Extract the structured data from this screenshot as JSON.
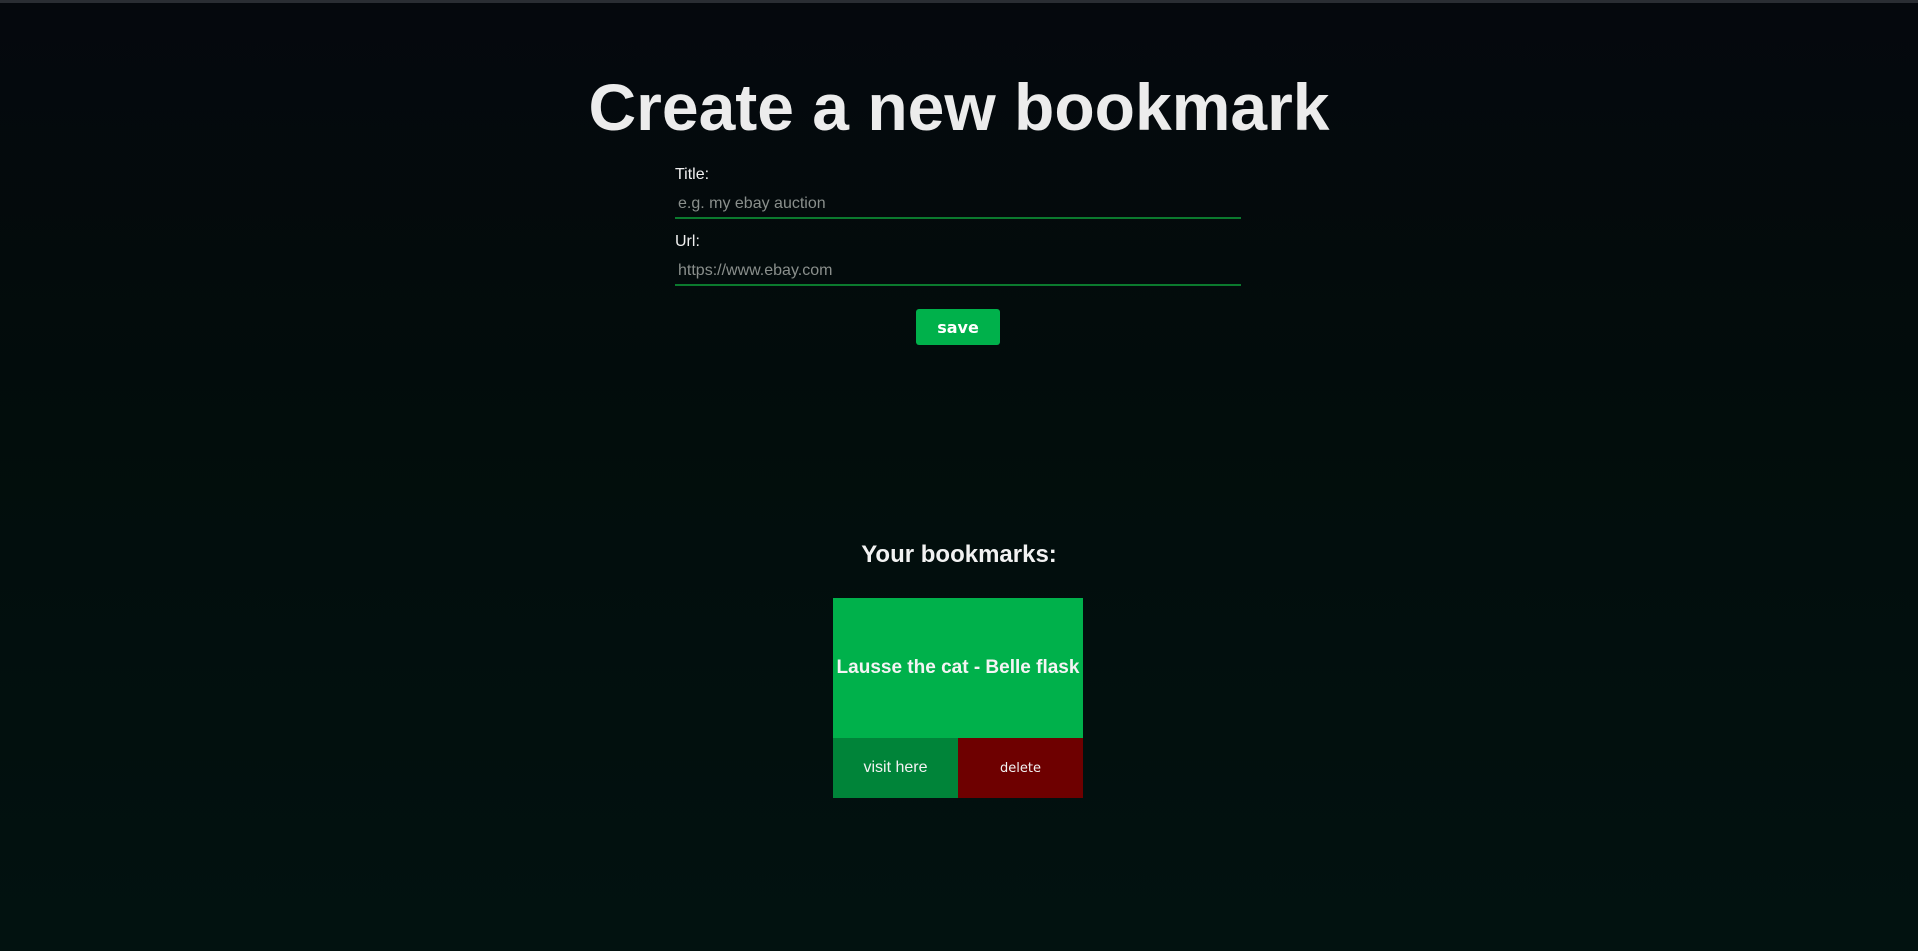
{
  "header": {
    "title": "Create a new bookmark"
  },
  "form": {
    "title_label": "Title:",
    "title_placeholder": "e.g. my ebay auction",
    "title_value": "",
    "url_label": "Url:",
    "url_placeholder": "https://www.ebay.com",
    "url_value": "",
    "save_label": "save"
  },
  "bookmarks": {
    "heading": "Your bookmarks:",
    "items": [
      {
        "title": "Lausse the cat - Belle flask",
        "visit_label": "visit here",
        "delete_label": "delete"
      }
    ]
  },
  "colors": {
    "accent": "#00b14b",
    "visit": "#008439",
    "delete": "#6e0000",
    "input_underline": "#0b7a2e"
  }
}
